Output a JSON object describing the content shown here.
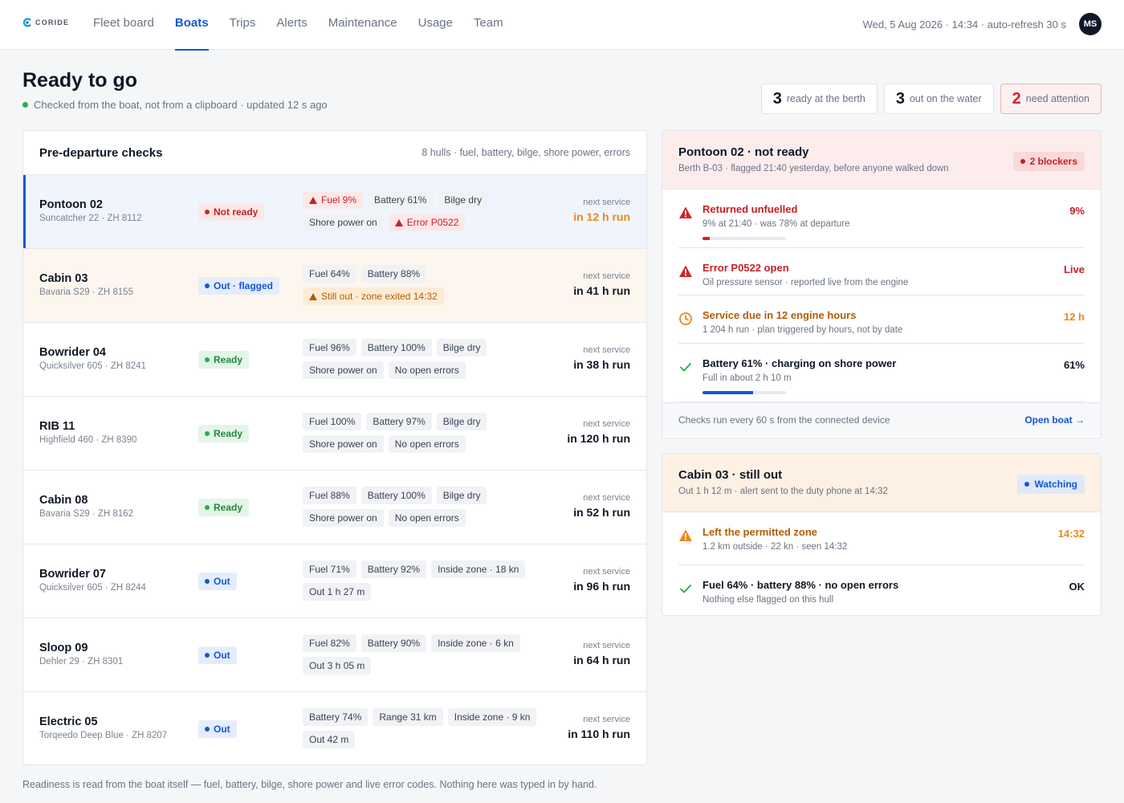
{
  "brand": {
    "name": "CORIDE"
  },
  "nav": [
    {
      "label": "Fleet board"
    },
    {
      "label": "Boats",
      "active": true
    },
    {
      "label": "Trips"
    },
    {
      "label": "Alerts"
    },
    {
      "label": "Maintenance"
    },
    {
      "label": "Usage"
    },
    {
      "label": "Team"
    }
  ],
  "header": {
    "datetime": "Wed, 5 Aug 2026 · 14:34 · auto-refresh 30 s",
    "avatar": "MS"
  },
  "page": {
    "title": "Ready to go",
    "subtitle": "Checked from the boat, not from a clipboard · updated 12 s ago"
  },
  "summary": [
    {
      "num": "3",
      "label": "ready at the berth"
    },
    {
      "num": "3",
      "label": "out on the water"
    },
    {
      "num": "2",
      "label": "need attention"
    }
  ],
  "checks": {
    "title": "Pre-departure checks",
    "meta": "8 hulls · fuel, battery, bilge, shore power, errors",
    "service_label": "next service",
    "rows": [
      {
        "name": "Pontoon 02",
        "model": "Suncatcher 22 · ZH 8112",
        "status": "Not ready",
        "chips": [
          "Fuel 9%",
          "Battery 61%",
          "Bilge dry",
          "Shore power on",
          "Error P0522"
        ],
        "service": "in 12 h run"
      },
      {
        "name": "Cabin 03",
        "model": "Bavaria S29 · ZH 8155",
        "status": "Out · flagged",
        "chips": [
          "Fuel 64%",
          "Battery 88%",
          "Still out · zone exited 14:32"
        ],
        "service": "in 41 h run"
      },
      {
        "name": "Bowrider 04",
        "model": "Quicksilver 605 · ZH 8241",
        "status": "Ready",
        "chips": [
          "Fuel 96%",
          "Battery 100%",
          "Bilge dry",
          "Shore power on",
          "No open errors"
        ],
        "service": "in 38 h run"
      },
      {
        "name": "RIB 11",
        "model": "Highfield 460 · ZH 8390",
        "status": "Ready",
        "chips": [
          "Fuel 100%",
          "Battery 97%",
          "Bilge dry",
          "Shore power on",
          "No open errors"
        ],
        "service": "in 120 h run"
      },
      {
        "name": "Cabin 08",
        "model": "Bavaria S29 · ZH 8162",
        "status": "Ready",
        "chips": [
          "Fuel 88%",
          "Battery 100%",
          "Bilge dry",
          "Shore power on",
          "No open errors"
        ],
        "service": "in 52 h run"
      },
      {
        "name": "Bowrider 07",
        "model": "Quicksilver 605 · ZH 8244",
        "status": "Out",
        "chips": [
          "Fuel 71%",
          "Battery 92%",
          "Inside zone · 18 kn",
          "Out 1 h 27 m"
        ],
        "service": "in 96 h run"
      },
      {
        "name": "Sloop 09",
        "model": "Dehler 29 · ZH 8301",
        "status": "Out",
        "chips": [
          "Fuel 82%",
          "Battery 90%",
          "Inside zone · 6 kn",
          "Out 3 h 05 m"
        ],
        "service": "in 64 h run"
      },
      {
        "name": "Electric 05",
        "model": "Torqeedo Deep Blue · ZH 8207",
        "status": "Out",
        "chips": [
          "Battery 74%",
          "Range 31 km",
          "Inside zone · 9 kn",
          "Out 42 m"
        ],
        "service": "in 110 h run"
      }
    ]
  },
  "footer": "Readiness is read from the boat itself — fuel, battery, bilge, shore power and live error codes. Nothing here was typed in by hand.",
  "pontoon_panel": {
    "title": "Pontoon 02 · not ready",
    "sub": "Berth B-03 · flagged 21:40 yesterday, before anyone walked down",
    "badge": "2 blockers",
    "items": [
      {
        "title": "Returned unfuelled",
        "sub": "9% at 21:40 · was 78% at departure",
        "value": "9%",
        "level": 0.09
      },
      {
        "title": "Error P0522 open",
        "sub": "Oil pressure sensor · reported live from the engine",
        "value": "Live"
      },
      {
        "title": "Service due in 12 engine hours",
        "sub": "1 204 h run · plan triggered by hours, not by date",
        "value": "12 h"
      },
      {
        "title": "Battery 61% · charging on shore power",
        "sub": "Full in about 2 h 10 m",
        "value": "61%",
        "level": 0.61
      }
    ],
    "foot_note": "Checks run every 60 s from the connected device",
    "foot_link": "Open boat →"
  },
  "cabin_panel": {
    "title": "Cabin 03 · still out",
    "sub": "Out 1 h 12 m · alert sent to the duty phone at 14:32",
    "badge": "Watching",
    "items": [
      {
        "title": "Left the permitted zone",
        "sub": "1.2 km outside · 22 kn · seen 14:32",
        "value": "14:32"
      },
      {
        "title": "Fuel 64% · battery 88% · no open errors",
        "sub": "Nothing else flagged on this hull",
        "value": "OK"
      }
    ]
  },
  "colors": {
    "accent": "#1656d6",
    "danger": "#d0242b",
    "warning": "#e8891c",
    "success": "#22b04b"
  }
}
